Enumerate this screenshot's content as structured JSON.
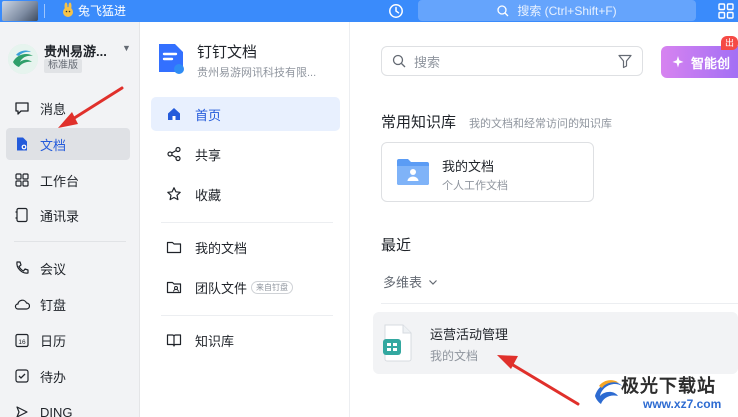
{
  "topbar": {
    "org_name": "兔飞猛进",
    "search_placeholder": "搜索 (Ctrl+Shift+F)"
  },
  "leftnav": {
    "org_title": "贵州易游...",
    "org_tag": "标准版",
    "items": [
      {
        "label": "消息",
        "icon": "message-icon"
      },
      {
        "label": "文档",
        "icon": "document-icon"
      },
      {
        "label": "工作台",
        "icon": "workbench-grid-icon"
      },
      {
        "label": "通讯录",
        "icon": "contacts-icon"
      },
      {
        "label": "会议",
        "icon": "phone-icon"
      },
      {
        "label": "钉盘",
        "icon": "cloud-icon"
      },
      {
        "label": "日历",
        "icon": "calendar-icon"
      },
      {
        "label": "待办",
        "icon": "todo-check-icon"
      },
      {
        "label": "DING",
        "icon": "ding-icon"
      }
    ],
    "calendar_day": "16"
  },
  "docside": {
    "title": "钉钉文档",
    "subtitle": "贵州易游网讯科技有限...",
    "items": [
      {
        "label": "首页",
        "icon": "home-icon"
      },
      {
        "label": "共享",
        "icon": "share-icon"
      },
      {
        "label": "收藏",
        "icon": "star-icon"
      },
      {
        "label": "我的文档",
        "icon": "folder-icon"
      },
      {
        "label": "团队文件",
        "icon": "team-folder-icon",
        "tag": "来自钉盘"
      },
      {
        "label": "知识库",
        "icon": "book-icon"
      }
    ]
  },
  "main": {
    "search_placeholder": "搜索",
    "smart_button": "智能创",
    "smart_badge": "出",
    "kb_section_title": "常用知识库",
    "kb_section_sub": "我的文档和经常访问的知识库",
    "kb_card": {
      "name": "我的文档",
      "desc": "个人工作文档"
    },
    "recent_title": "最近",
    "filter_label": "多维表",
    "recent_items": [
      {
        "name": "运营活动管理",
        "location": "我的文档"
      }
    ]
  },
  "watermark": {
    "text": "极光下载站",
    "url": "www.xz7.com"
  },
  "colors": {
    "topbar": "#3a8bfb",
    "active_blue": "#245bdb",
    "arrow_red": "#e0302b"
  }
}
